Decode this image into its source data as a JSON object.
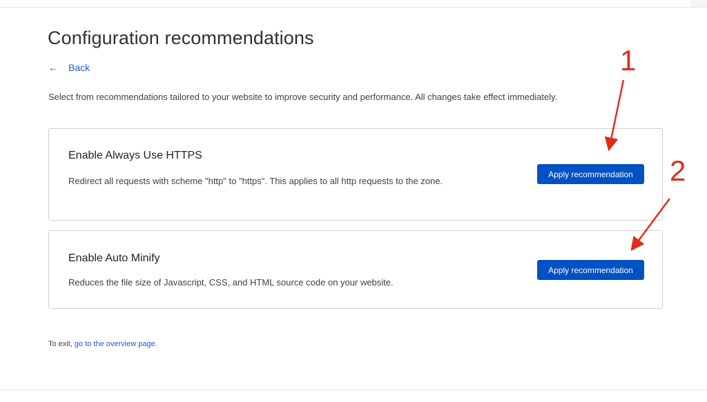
{
  "page": {
    "title": "Configuration recommendations",
    "back_label": "Back",
    "intro": "Select from recommendations tailored to your website to improve security and performance. All changes take effect immediately."
  },
  "recommendations": [
    {
      "title": "Enable Always Use HTTPS",
      "description": "Redirect all requests with scheme \"http\" to \"https\". This applies to all http requests to the zone.",
      "button_label": "Apply recommendation"
    },
    {
      "title": "Enable Auto Minify",
      "description": "Reduces the file size of Javascript, CSS, and HTML source code on your website.",
      "button_label": "Apply recommendation"
    }
  ],
  "footer": {
    "exit_prefix": "To exit, ",
    "exit_link": "go to the overview page",
    "exit_suffix": "."
  },
  "annotations": {
    "marker_1": "1",
    "marker_2": "2",
    "color": "#e32b1d"
  },
  "colors": {
    "accent": "#0051c3",
    "link": "#1d5bd1",
    "annotation": "#e32b1d"
  },
  "icons": {
    "back": "arrow-left-icon"
  }
}
